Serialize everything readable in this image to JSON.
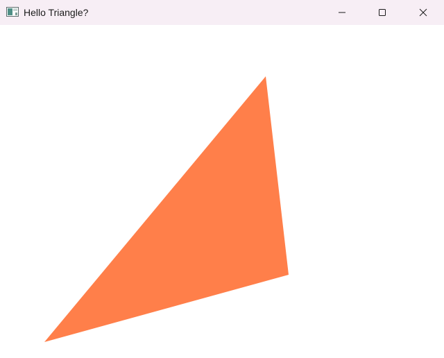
{
  "window": {
    "title": "Hello Triangle?",
    "titlebar_color": "#f7eef5",
    "background_color": "#ffffff"
  },
  "icons": {
    "app": "app-window-icon",
    "minimize": "minimize-icon",
    "maximize": "maximize-icon",
    "close": "close-icon"
  },
  "scene": {
    "shape": "triangle",
    "fill_color": "#ff7f4a"
  }
}
